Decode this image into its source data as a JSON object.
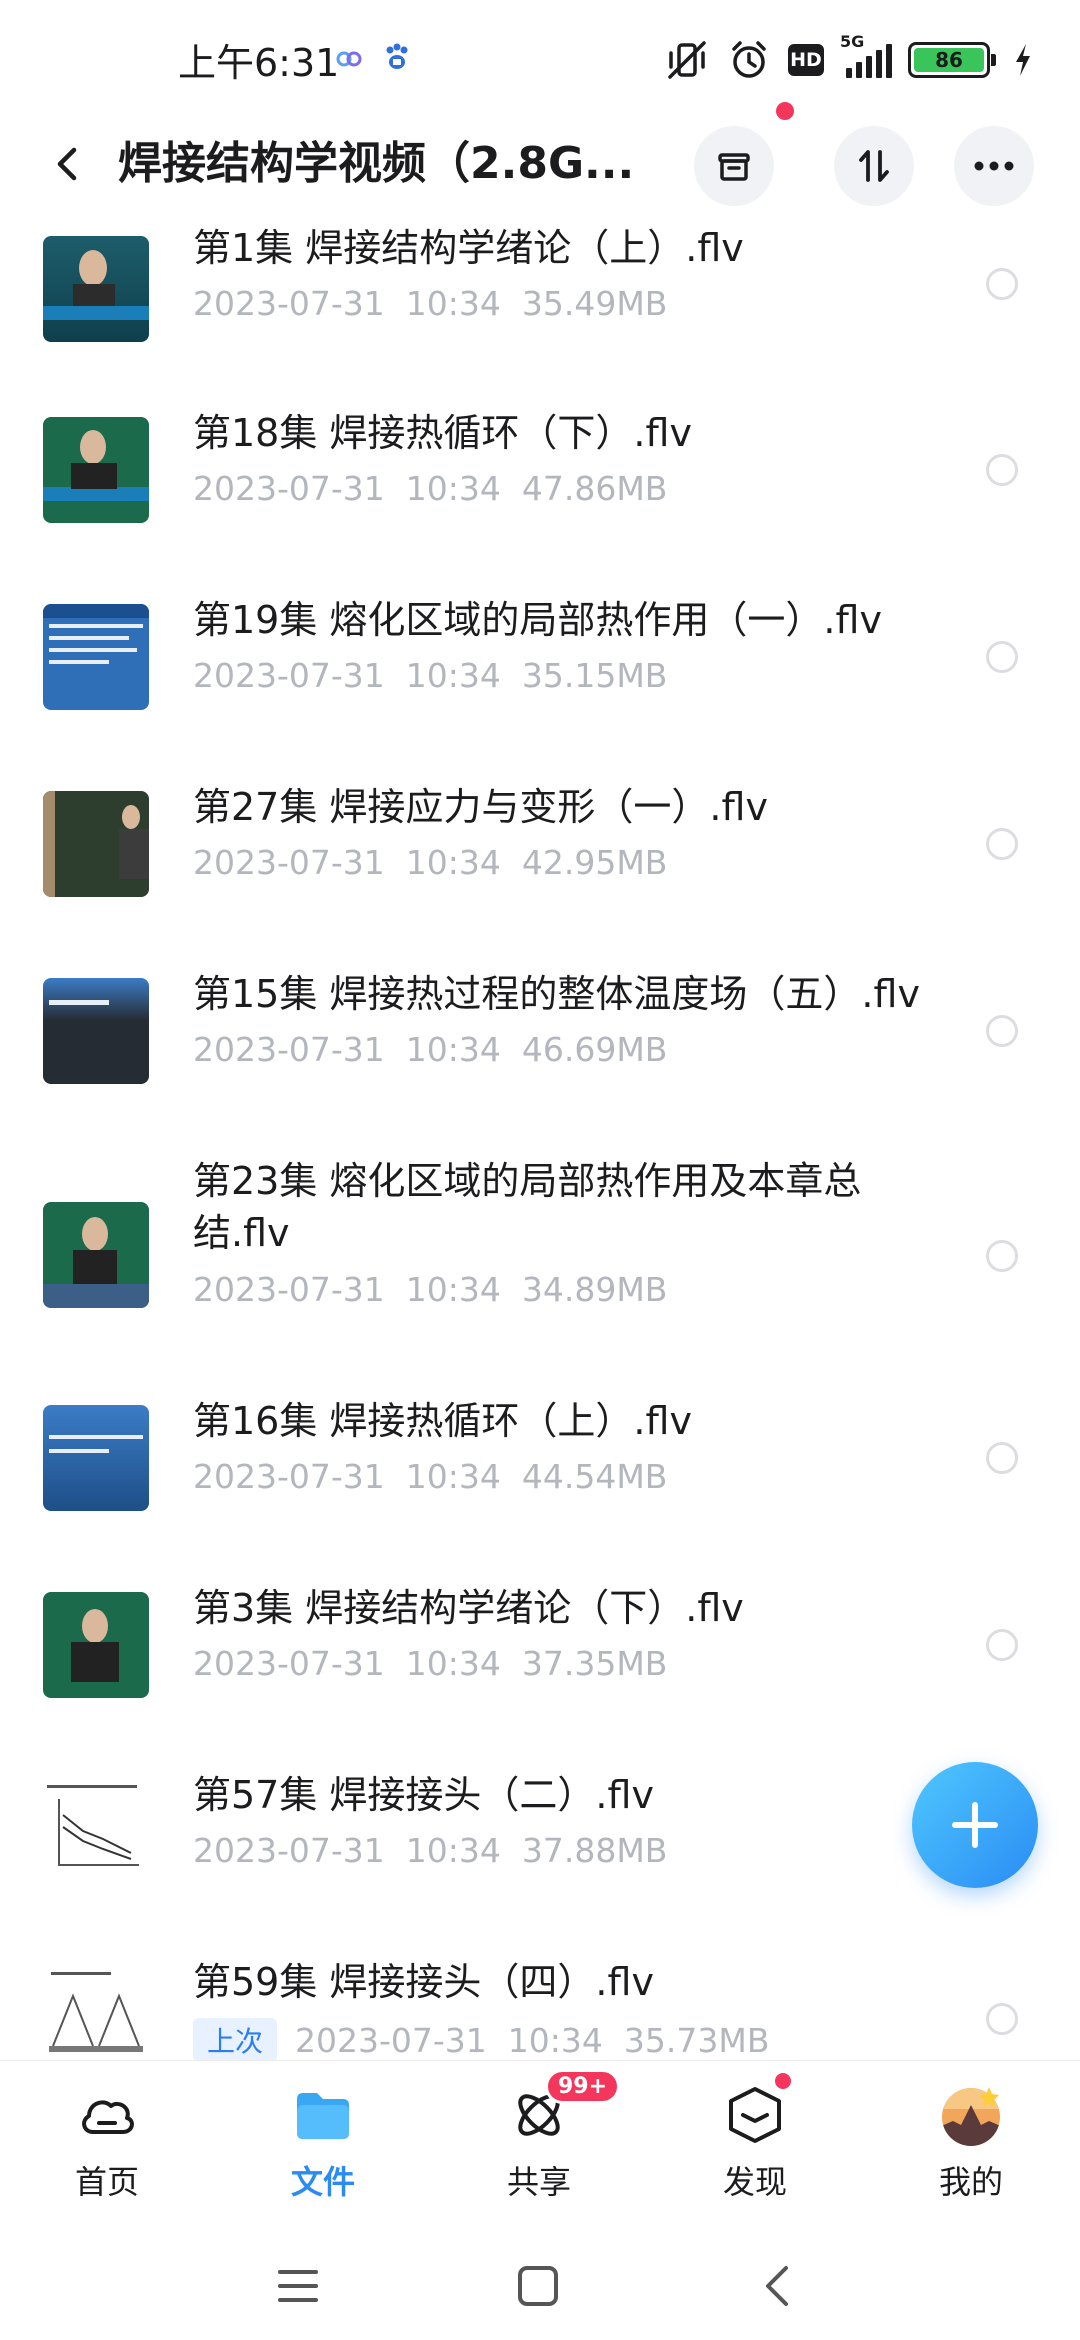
{
  "status_bar": {
    "time": "上午6:31",
    "hd": "HD",
    "network": "5G",
    "battery": "86"
  },
  "header": {
    "title": "焊接结构学视频（2.8G..."
  },
  "files": [
    {
      "title": "第1集 焊接结构学绪论（上）.flv",
      "date": "2023-07-31",
      "time": "10:34",
      "size": "35.49MB"
    },
    {
      "title": "第18集 焊接热循环（下）.flv",
      "date": "2023-07-31",
      "time": "10:34",
      "size": "47.86MB"
    },
    {
      "title": "第19集 熔化区域的局部热作用（一）.flv",
      "date": "2023-07-31",
      "time": "10:34",
      "size": "35.15MB"
    },
    {
      "title": "第27集 焊接应力与变形（一）.flv",
      "date": "2023-07-31",
      "time": "10:34",
      "size": "42.95MB"
    },
    {
      "title": "第15集 焊接热过程的整体温度场（五）.flv",
      "date": "2023-07-31",
      "time": "10:34",
      "size": "46.69MB"
    },
    {
      "title": "第23集 熔化区域的局部热作用及本章总结.flv",
      "date": "2023-07-31",
      "time": "10:34",
      "size": "34.89MB"
    },
    {
      "title": "第16集 焊接热循环（上）.flv",
      "date": "2023-07-31",
      "time": "10:34",
      "size": "44.54MB"
    },
    {
      "title": "第3集 焊接结构学绪论（下）.flv",
      "date": "2023-07-31",
      "time": "10:34",
      "size": "37.35MB"
    },
    {
      "title": "第57集 焊接接头（二）.flv",
      "date": "2023-07-31",
      "time": "10:34",
      "size": "37.88MB"
    },
    {
      "title": "第59集 焊接接头（四）.flv",
      "date": "2023-07-31",
      "time": "10:34",
      "size": "35.73MB",
      "tag": "上次"
    }
  ],
  "nav": {
    "home": "首页",
    "files": "文件",
    "share": "共享",
    "share_badge": "99+",
    "discover": "发现",
    "mine": "我的"
  },
  "colors": {
    "accent": "#2a8cf3",
    "badge": "#f5365c",
    "meta_text": "#b3b6bd"
  }
}
